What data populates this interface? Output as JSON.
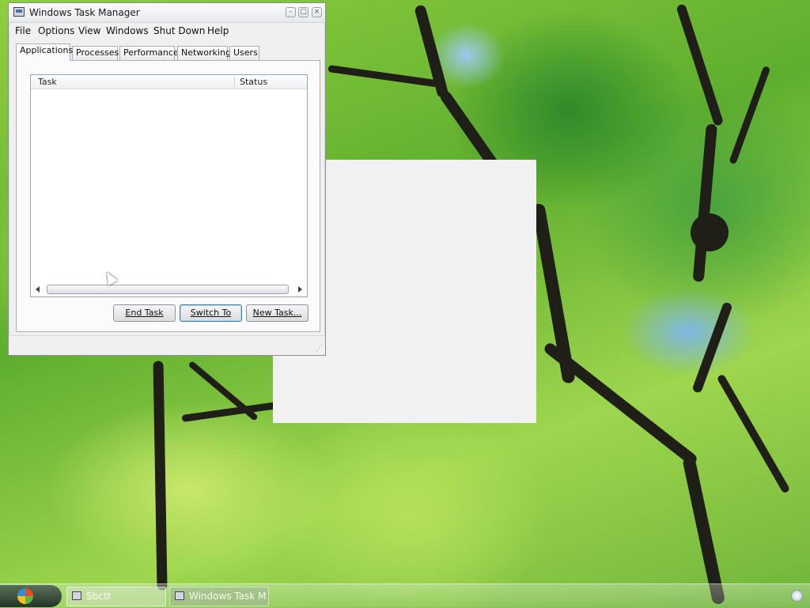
{
  "window": {
    "title": "Windows Task Manager",
    "controls": {
      "minimize": "minimize-icon",
      "maximize": "maximize-icon",
      "close": "close-icon"
    }
  },
  "menu": [
    "File",
    "Options",
    "View",
    "Windows",
    "Shut Down",
    "Help"
  ],
  "tabs": [
    "Applications",
    "Processes",
    "Performance",
    "Networking",
    "Users"
  ],
  "active_tab": "Applications",
  "list": {
    "columns": [
      "Task",
      "Status"
    ],
    "rows": []
  },
  "buttons": {
    "end_task": "End Task",
    "switch_to": "Switch To",
    "new_task": "New Task..."
  },
  "taskbar": {
    "items": [
      {
        "label": "Sbctt",
        "icon": "window-icon"
      },
      {
        "label": "Windows Task M",
        "icon": "task-manager-icon",
        "active": true
      }
    ]
  },
  "colors": {
    "window_bg": "#f0f0f0",
    "default_button_border": "#3c7fb1",
    "desktop_green": "#8fcf3e"
  }
}
